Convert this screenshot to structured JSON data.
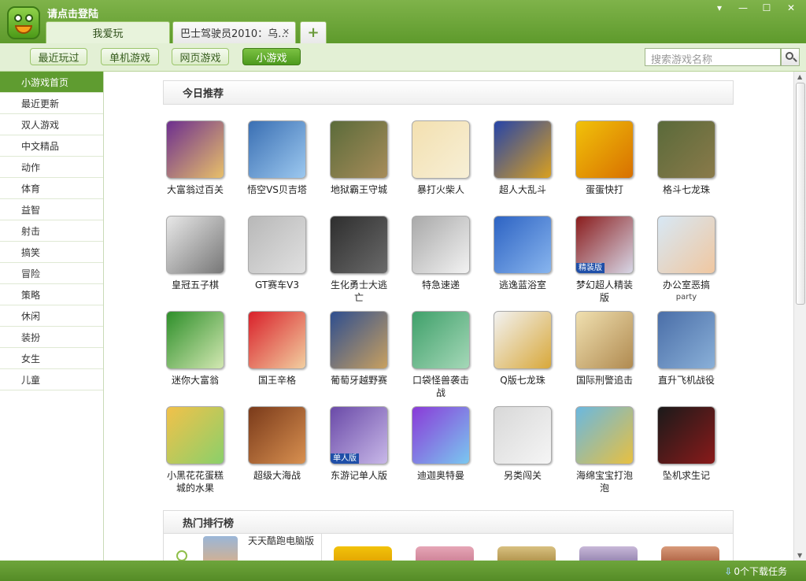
{
  "header": {
    "login_text": "请点击登陆",
    "tabs": [
      {
        "label": "我爱玩",
        "active": true
      },
      {
        "label": "巴士驾驶员2010：乌…",
        "active": false
      }
    ],
    "add_tab": "+",
    "close_tab": "✕",
    "window_buttons": [
      "▾",
      "—",
      "☐",
      "✕"
    ]
  },
  "subnav": {
    "buttons": [
      "最近玩过",
      "单机游戏",
      "网页游戏",
      "小游戏"
    ],
    "active": "小游戏",
    "search_placeholder": "搜索游戏名称"
  },
  "sidebar": {
    "items": [
      "小游戏首页",
      "最近更新",
      "双人游戏",
      "中文精品",
      "动作",
      "体育",
      "益智",
      "射击",
      "搞笑",
      "冒险",
      "策略",
      "休闲",
      "装扮",
      "女生",
      "儿童"
    ],
    "active": "小游戏首页"
  },
  "content": {
    "today_title": "今日推荐",
    "hot_title": "热门排行榜",
    "games": [
      {
        "name": "大富翁过百关",
        "icon": "bomber-purple-icon",
        "colors": [
          "#6d2f8f",
          "#e8c06a"
        ]
      },
      {
        "name": "悟空VS贝吉塔",
        "icon": "anime-fighter-icon",
        "colors": [
          "#3a6fb3",
          "#9cc8ef"
        ]
      },
      {
        "name": "地狱霸王守城",
        "icon": "goblin-warriors-icon",
        "colors": [
          "#5b6b3a",
          "#a78c5a"
        ]
      },
      {
        "name": "暴打火柴人",
        "icon": "stickman-icon",
        "colors": [
          "#f3e0b0",
          "#f7efd6"
        ]
      },
      {
        "name": "超人大乱斗",
        "icon": "robot-hero-icon",
        "colors": [
          "#2644a8",
          "#d9a020"
        ]
      },
      {
        "name": "蛋蛋快打",
        "icon": "egg-fighter-icon",
        "colors": [
          "#f1c20a",
          "#d87000"
        ]
      },
      {
        "name": "格斗七龙珠",
        "icon": "dragonball-battle-icon",
        "colors": [
          "#5a6a3a",
          "#8a7a4a"
        ]
      },
      {
        "name": "皇冠五子棋",
        "icon": "sketch-scholar-icon",
        "colors": [
          "#e8e8e8",
          "#777777"
        ]
      },
      {
        "name": "GT赛车V3",
        "icon": "race-car-icon",
        "colors": [
          "#b8b8b8",
          "#e0e0e0"
        ]
      },
      {
        "name": "生化勇士大逃亡",
        "icon": "dark-soldier-icon",
        "colors": [
          "#2e2e2e",
          "#6a6a6a"
        ]
      },
      {
        "name": "特急速递",
        "icon": "bullet-train-icon",
        "colors": [
          "#a9a9a9",
          "#f2f2f2"
        ]
      },
      {
        "name": "逃逸蓝浴室",
        "icon": "blue-bathroom-icon",
        "colors": [
          "#2d63c3",
          "#88b5ee"
        ]
      },
      {
        "name": "梦幻超人精装版",
        "icon": "masked-hero-icon",
        "colors": [
          "#8a1c1c",
          "#d7d7e7"
        ]
      },
      {
        "name": "办公室恶搞",
        "icon": "office-cartoon-icon",
        "colors": [
          "#d7e8f5",
          "#f0c7a0"
        ]
      },
      {
        "name": "迷你大富翁",
        "icon": "mini-monopoly-icon",
        "colors": [
          "#2e8f2a",
          "#d3e8b2"
        ]
      },
      {
        "name": "国王辛格",
        "icon": "king-icon",
        "colors": [
          "#d9202a",
          "#f2cfa0"
        ]
      },
      {
        "name": "葡萄牙越野赛",
        "icon": "rally-car-icon",
        "colors": [
          "#2e4e8f",
          "#c8a060"
        ]
      },
      {
        "name": "口袋怪兽袭击战",
        "icon": "pocket-monster-icon",
        "colors": [
          "#3fa06a",
          "#a5d8b8"
        ]
      },
      {
        "name": "Q版七龙珠",
        "icon": "dragonball-logo-icon",
        "colors": [
          "#f2f2f2",
          "#d8a83a"
        ]
      },
      {
        "name": "国际刑警追击",
        "icon": "police-chase-icon",
        "colors": [
          "#f0e0b0",
          "#b08a50"
        ]
      },
      {
        "name": "直升飞机战役",
        "icon": "helicopter-icon",
        "colors": [
          "#4a6ea8",
          "#8ab0d8"
        ]
      },
      {
        "name": "小黑花花蛋糕城的水果",
        "icon": "cartoon-kids-icon",
        "colors": [
          "#f2c14a",
          "#8ad06a"
        ]
      },
      {
        "name": "超级大海战",
        "icon": "pirate-ship-icon",
        "colors": [
          "#7a3a1a",
          "#d89050"
        ]
      },
      {
        "name": "东游记单人版",
        "icon": "anime-girl-icon",
        "colors": [
          "#6a4aa8",
          "#c8b8e8"
        ]
      },
      {
        "name": "迪迦奥特曼",
        "icon": "blue-hero-icon",
        "colors": [
          "#8a3ad8",
          "#7ac8f0"
        ]
      },
      {
        "name": "另类闯关",
        "icon": "pixel-man-icon",
        "colors": [
          "#d8d8d8",
          "#f5f5f5"
        ]
      },
      {
        "name": "海绵宝宝打泡泡",
        "icon": "sponge-cartoon-icon",
        "colors": [
          "#6ab8e0",
          "#e8c040"
        ]
      },
      {
        "name": "坠机求生记",
        "icon": "crashed-jet-icon",
        "colors": [
          "#1a1a1a",
          "#8a1a1a"
        ]
      }
    ],
    "thumb_badges": {
      "梦幻超人精装版": "精装版",
      "东游记单人版": "单人版"
    },
    "name_lines": {
      "生化勇士大逃亡": [
        "生化勇士大逃",
        "亡"
      ],
      "梦幻超人精装版": [
        "梦幻超人精装",
        "版"
      ],
      "办公室恶搞": [
        "办公室恶搞",
        "party"
      ],
      "口袋怪兽袭击战": [
        "口袋怪兽袭击",
        "战"
      ],
      "小黑花花蛋糕城的水果": [
        "小黑花花蛋糕",
        "城的水果"
      ],
      "海绵宝宝打泡泡": [
        "海绵宝宝打泡",
        "泡"
      ]
    },
    "hot_first_name": "天天酷跑电脑版"
  },
  "statusbar": {
    "download_text": "0个下载任务"
  }
}
